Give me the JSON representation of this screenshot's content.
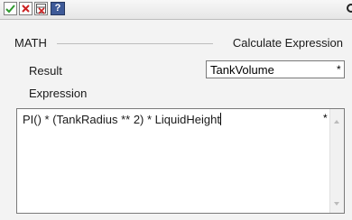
{
  "toolbar": {
    "buttons": [
      {
        "name": "check-icon",
        "color": "#2e9a2e"
      },
      {
        "name": "close-x-icon",
        "color": "#cc2222"
      },
      {
        "name": "table-delete-icon",
        "color": "#cc2222"
      },
      {
        "name": "help-icon",
        "label": "?",
        "color": "#3e5a98"
      }
    ]
  },
  "header": {
    "section": "MATH",
    "title": "Calculate Expression"
  },
  "result": {
    "label": "Result",
    "value": "TankVolume",
    "required_marker": "*"
  },
  "expression": {
    "label": "Expression",
    "value": "PI() * (TankRadius ** 2) * LiquidHeight",
    "required_marker": "*"
  }
}
